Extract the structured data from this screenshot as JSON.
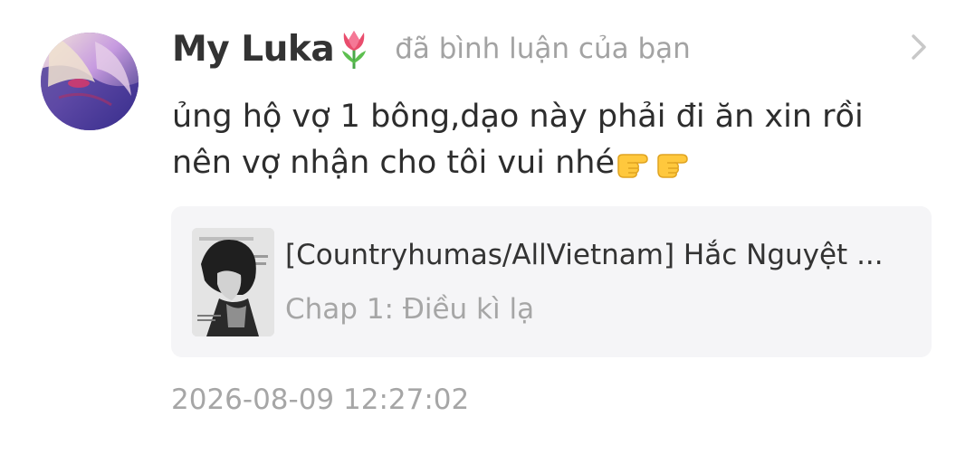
{
  "notification": {
    "username": "My Luka",
    "username_emoji": "tulip-emoji",
    "action_text": "đã bình luận của bạn",
    "comment_line1": "ủng hộ vợ 1 bông,dạo này phải đi ăn xin rồi",
    "comment_line2": "nên vợ nhận cho tôi vui nhé",
    "comment_emojis": [
      "pointing-right-emoji",
      "pointing-right-emoji"
    ],
    "story": {
      "title": "[Countryhumas/AllVietnam] Hắc Nguyệt ...",
      "chapter": "Chap 1: Điều kì lạ"
    },
    "timestamp": "2026-08-09 12:27:02"
  },
  "colors": {
    "background": "#ffffff",
    "username": "#333333",
    "secondary_text": "#a6a6a6",
    "card_background": "#f5f5f7",
    "chevron": "#c8c8c8"
  }
}
